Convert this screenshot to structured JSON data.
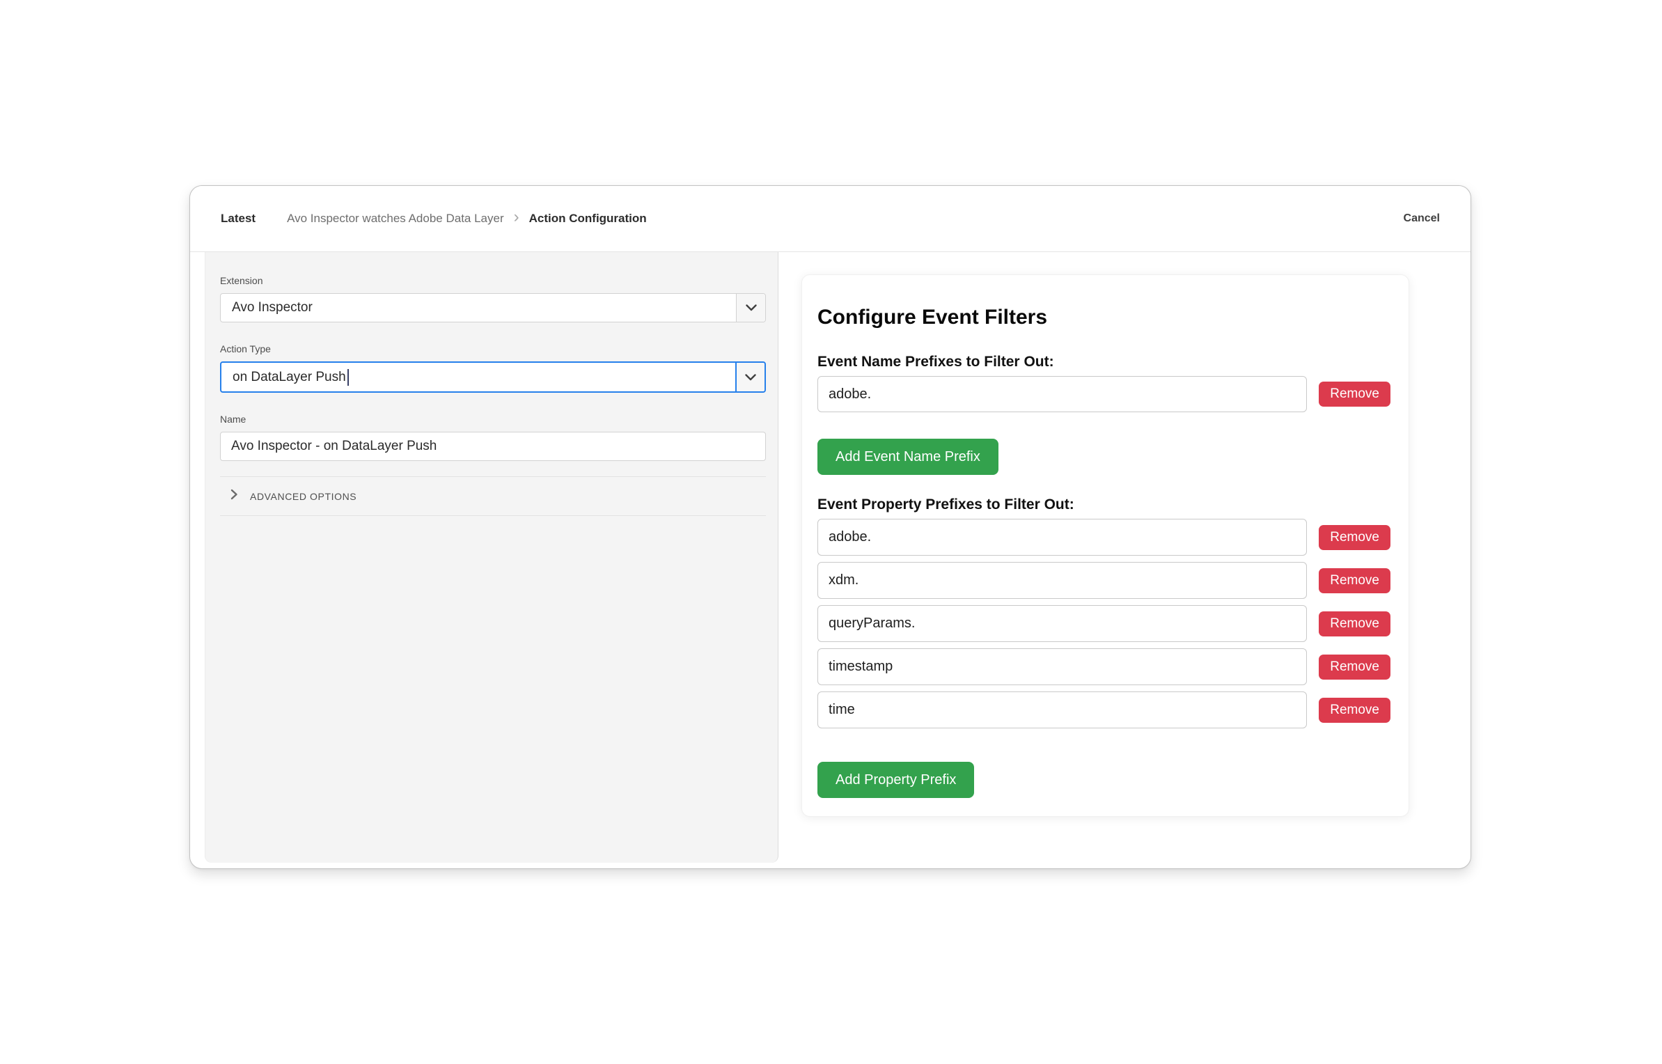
{
  "header": {
    "environment": "Latest",
    "breadcrumb_parent": "Avo Inspector watches Adobe Data Layer",
    "breadcrumb_separator": "›",
    "breadcrumb_current": "Action Configuration",
    "cancel_label": "Cancel"
  },
  "form": {
    "extension": {
      "label": "Extension",
      "value": "Avo Inspector"
    },
    "action_type": {
      "label": "Action Type",
      "value": "on DataLayer Push"
    },
    "name": {
      "label": "Name",
      "value": "Avo Inspector - on DataLayer Push"
    },
    "advanced_options_label": "ADVANCED OPTIONS"
  },
  "filters": {
    "title": "Configure Event Filters",
    "event_name_section": {
      "label": "Event Name Prefixes to Filter Out:",
      "items": [
        {
          "value": "adobe.",
          "remove_label": "Remove"
        }
      ],
      "add_button_label": "Add Event Name Prefix"
    },
    "event_property_section": {
      "label": "Event Property Prefixes to Filter Out:",
      "items": [
        {
          "value": "adobe.",
          "remove_label": "Remove"
        },
        {
          "value": "xdm.",
          "remove_label": "Remove"
        },
        {
          "value": "queryParams.",
          "remove_label": "Remove"
        },
        {
          "value": "timestamp",
          "remove_label": "Remove"
        },
        {
          "value": "time",
          "remove_label": "Remove"
        }
      ],
      "add_button_label": "Add Property Prefix"
    }
  },
  "colors": {
    "accent_green": "#33a24d",
    "danger_red": "#dc3b4d",
    "focus_blue": "#2680eb",
    "panel_gray": "#f4f4f4"
  }
}
